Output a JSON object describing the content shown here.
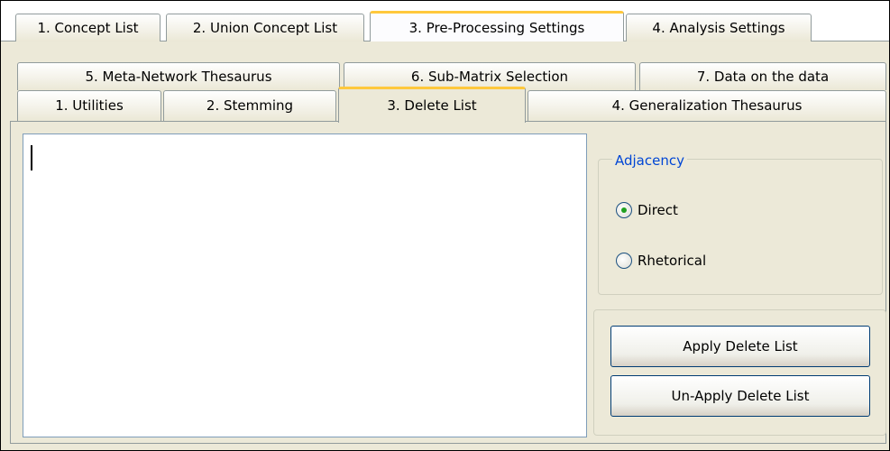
{
  "top_tabs": [
    {
      "label": "1. Concept List"
    },
    {
      "label": "2. Union Concept List"
    },
    {
      "label": "3. Pre-Processing Settings"
    },
    {
      "label": "4. Analysis Settings"
    }
  ],
  "sub_tabs_back": [
    {
      "label": "5. Meta-Network Thesaurus"
    },
    {
      "label": "6. Sub-Matrix Selection"
    },
    {
      "label": "7. Data on the data"
    }
  ],
  "sub_tabs_front": [
    {
      "label": "1. Utilities"
    },
    {
      "label": "2. Stemming"
    },
    {
      "label": "3. Delete List"
    },
    {
      "label": "4. Generalization Thesaurus"
    }
  ],
  "delete_list": {
    "text": ""
  },
  "adjacency": {
    "legend": "Adjacency",
    "options": [
      {
        "label": "Direct",
        "selected": true
      },
      {
        "label": "Rhetorical",
        "selected": false
      }
    ]
  },
  "buttons": {
    "apply": "Apply Delete List",
    "unapply": "Un-Apply Delete List"
  },
  "colors": {
    "accent_tab": "#ffc83c",
    "legend_text": "#0046d5",
    "radio_dot": "#21a121"
  }
}
